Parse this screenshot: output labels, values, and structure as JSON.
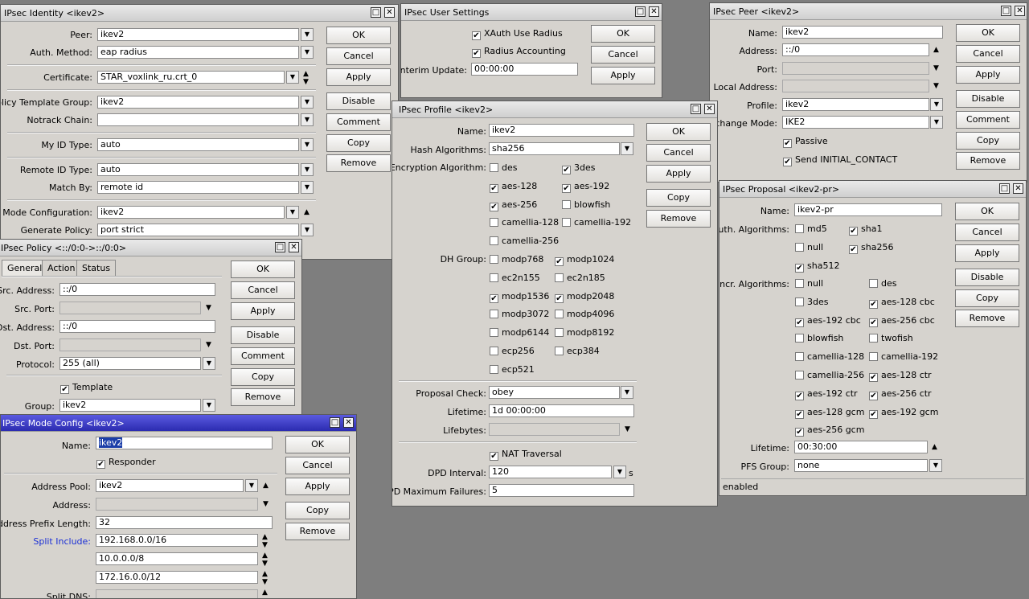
{
  "common": {
    "ok": "OK",
    "cancel": "Cancel",
    "apply": "Apply",
    "disable": "Disable",
    "comment": "Comment",
    "copy": "Copy",
    "remove": "Remove",
    "min": "□",
    "close": "✕"
  },
  "identity": {
    "title": "IPsec Identity <ikev2>",
    "peer_label": "Peer:",
    "peer": "ikev2",
    "auth_label": "Auth. Method:",
    "auth": "eap radius",
    "cert_label": "Certificate:",
    "cert": "STAR_voxlink_ru.crt_0",
    "policy_label": "Policy Template Group:",
    "policy": "ikev2",
    "notrack_label": "Notrack Chain:",
    "notrack": "",
    "myid_label": "My ID Type:",
    "myid": "auto",
    "remoteid_label": "Remote ID Type:",
    "remoteid": "auto",
    "match_label": "Match By:",
    "match": "remote id",
    "mode_label": "Mode Configuration:",
    "mode": "ikev2",
    "genpol_label": "Generate Policy:",
    "genpol": "port strict"
  },
  "user_settings": {
    "title": "IPsec User Settings",
    "xauth": "XAuth Use Radius",
    "radius_acc": "Radius Accounting",
    "interim_label": "Interim Update:",
    "interim": "00:00:00"
  },
  "peer": {
    "title": "IPsec Peer <ikev2>",
    "name_label": "Name:",
    "name": "ikev2",
    "address_label": "Address:",
    "address": "::/0",
    "port_label": "Port:",
    "port": "",
    "local_label": "Local Address:",
    "local": "",
    "profile_label": "Profile:",
    "profile": "ikev2",
    "exchange_label": "Exchange Mode:",
    "exchange": "IKE2",
    "passive": "Passive",
    "initial": "Send INITIAL_CONTACT"
  },
  "policy": {
    "title": "IPsec Policy <::/0:0->::/0:0>",
    "tabs": [
      "General",
      "Action",
      "Status"
    ],
    "src_label": "Src. Address:",
    "src": "::/0",
    "srcport_label": "Src. Port:",
    "srcport": "",
    "dst_label": "Dst. Address:",
    "dst": "::/0",
    "dstport_label": "Dst. Port:",
    "dstport": "",
    "proto_label": "Protocol:",
    "proto": "255 (all)",
    "template": "Template",
    "group_label": "Group:",
    "group": "ikev2"
  },
  "profile": {
    "title": "IPsec Profile <ikev2>",
    "name_label": "Name:",
    "name": "ikev2",
    "hash_label": "Hash Algorithms:",
    "hash": "sha256",
    "enc_label": "Encryption Algorithm:",
    "enc": [
      [
        "des",
        false
      ],
      [
        "3des",
        true
      ],
      [
        "aes-128",
        true
      ],
      [
        "aes-192",
        true
      ],
      [
        "aes-256",
        true
      ],
      [
        "blowfish",
        false
      ],
      [
        "camellia-128",
        false
      ],
      [
        "camellia-192",
        false
      ],
      [
        "camellia-256",
        false
      ]
    ],
    "dh_label": "DH Group:",
    "dh": [
      [
        "modp768",
        false
      ],
      [
        "modp1024",
        true
      ],
      [
        "ec2n155",
        false
      ],
      [
        "ec2n185",
        false
      ],
      [
        "modp1536",
        true
      ],
      [
        "modp2048",
        true
      ],
      [
        "modp3072",
        false
      ],
      [
        "modp4096",
        false
      ],
      [
        "modp6144",
        false
      ],
      [
        "modp8192",
        false
      ],
      [
        "ecp256",
        false
      ],
      [
        "ecp384",
        false
      ],
      [
        "ecp521",
        false
      ]
    ],
    "proposal_check_label": "Proposal Check:",
    "proposal_check": "obey",
    "lifetime_label": "Lifetime:",
    "lifetime": "1d 00:00:00",
    "lifebytes_label": "Lifebytes:",
    "lifebytes": "",
    "nat": "NAT Traversal",
    "dpd_label": "DPD Interval:",
    "dpd": "120",
    "dpd_unit": "s",
    "dpdmax_label": "DPD Maximum Failures:",
    "dpdmax": "5"
  },
  "proposal": {
    "title": "IPsec Proposal <ikev2-pr>",
    "name_label": "Name:",
    "name": "ikev2-pr",
    "auth_label": "Auth. Algorithms:",
    "auth": [
      [
        "md5",
        false
      ],
      [
        "sha1",
        true
      ],
      [
        "null",
        false
      ],
      [
        "sha256",
        true
      ],
      [
        "sha512",
        true
      ]
    ],
    "encr_label": "Encr. Algorithms:",
    "encr": [
      [
        "null",
        false
      ],
      [
        "des",
        false
      ],
      [
        "3des",
        false
      ],
      [
        "aes-128 cbc",
        true
      ],
      [
        "aes-192 cbc",
        true
      ],
      [
        "aes-256 cbc",
        true
      ],
      [
        "blowfish",
        false
      ],
      [
        "twofish",
        false
      ],
      [
        "camellia-128",
        false
      ],
      [
        "camellia-192",
        false
      ],
      [
        "camellia-256",
        false
      ],
      [
        "aes-128 ctr",
        true
      ],
      [
        "aes-192 ctr",
        true
      ],
      [
        "aes-256 ctr",
        true
      ],
      [
        "aes-128 gcm",
        true
      ],
      [
        "aes-192 gcm",
        true
      ],
      [
        "aes-256 gcm",
        true
      ]
    ],
    "lifetime_label": "Lifetime:",
    "lifetime": "00:30:00",
    "pfs_label": "PFS Group:",
    "pfs": "none",
    "status": "enabled"
  },
  "mode_config": {
    "title": "IPsec Mode Config <ikev2>",
    "name_label": "Name:",
    "name": "ikev2",
    "responder": "Responder",
    "pool_label": "Address Pool:",
    "pool": "ikev2",
    "address_label": "Address:",
    "address": "",
    "prefix_label": "Address Prefix Length:",
    "prefix": "32",
    "split_label": "Split Include:",
    "split": [
      "192.168.0.0/16",
      "10.0.0.0/8",
      "172.16.0.0/12"
    ],
    "splitdns_label": "Split DNS:",
    "splitdns": ""
  }
}
